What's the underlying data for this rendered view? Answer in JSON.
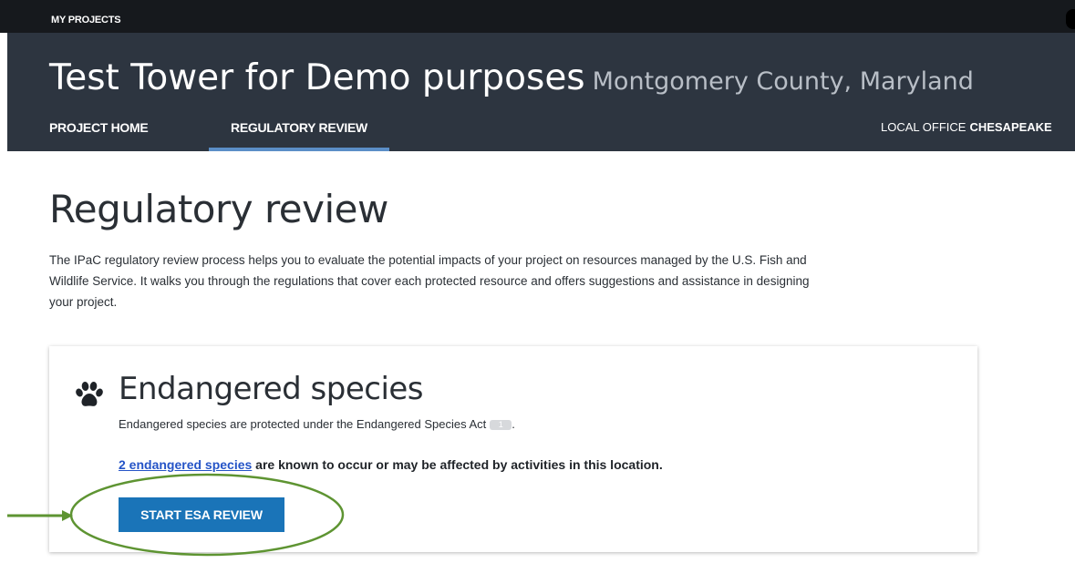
{
  "topbar": {
    "my_projects_label": "MY PROJECTS"
  },
  "header": {
    "project_title": "Test Tower for Demo purposes",
    "project_location": "Montgomery County, Maryland",
    "nav": {
      "project_home_label": "PROJECT HOME",
      "regulatory_review_label": "REGULATORY REVIEW"
    },
    "local_office_label": "LOCAL OFFICE",
    "local_office_name": "CHESAPEAKE"
  },
  "main": {
    "heading": "Regulatory review",
    "intro": "The IPaC regulatory review process helps you to evaluate the potential impacts of your project on resources managed by the U.S. Fish and Wildlife Service. It walks you through the regulations that cover each protected resource and offers suggestions and assistance in designing your project.",
    "card": {
      "icon": "paw-icon",
      "title": "Endangered species",
      "description": "Endangered species are protected under the Endangered Species Act",
      "footnote_number": "1",
      "description_end": ".",
      "species_link": "2 endangered species",
      "species_text": " are known to occur or may be affected by activities in this location.",
      "button_label": "START ESA REVIEW"
    }
  },
  "colors": {
    "topbar_bg": "#16191d",
    "header_bg": "#2d3540",
    "active_tab_underline": "#5b8ec7",
    "primary_button": "#1a74b8",
    "link": "#2554c7",
    "annotation": "#5e9432"
  }
}
